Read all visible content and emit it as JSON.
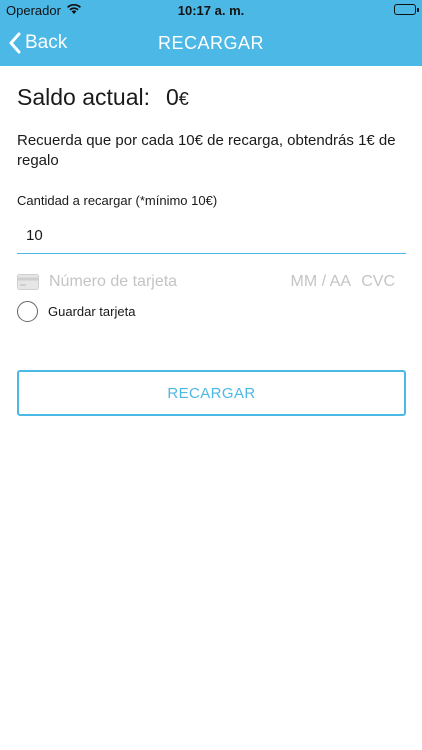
{
  "status_bar": {
    "carrier": "Operador",
    "time": "10:17 a. m."
  },
  "nav": {
    "back_label": "Back",
    "title": "RECARGAR"
  },
  "balance": {
    "label": "Saldo actual:",
    "amount": "0",
    "currency": "€"
  },
  "info_text": "Recuerda que por cada 10€ de recarga, obtendrás 1€ de regalo",
  "amount_field": {
    "label": "Cantidad a recargar (*mínimo 10€)",
    "value": "10"
  },
  "card": {
    "number_placeholder": "Número de tarjeta",
    "expiry_placeholder": "MM / AA",
    "cvc_placeholder": "CVC"
  },
  "save_card_label": "Guardar tarjeta",
  "submit_label": "RECARGAR",
  "colors": {
    "accent": "#4cb8e6",
    "placeholder": "#c4c4c4"
  }
}
